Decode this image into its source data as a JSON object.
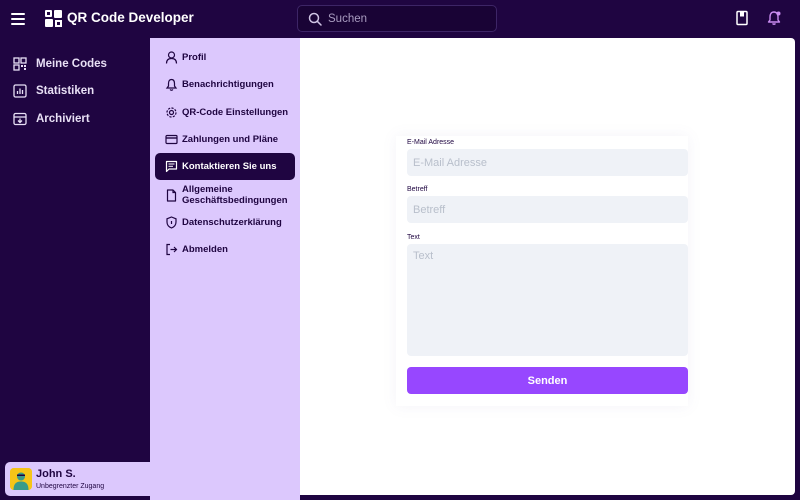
{
  "app": {
    "title": "QR Code Developer"
  },
  "search": {
    "placeholder": "Suchen"
  },
  "sidebar": {
    "items": [
      {
        "label": "Meine Codes",
        "icon": "qr-icon"
      },
      {
        "label": "Statistiken",
        "icon": "chart-icon"
      },
      {
        "label": "Archiviert",
        "icon": "archive-icon"
      }
    ]
  },
  "settings_menu": {
    "items": [
      {
        "label": "Profil",
        "icon": "user-icon"
      },
      {
        "label": "Benachrichtigungen",
        "icon": "bell-icon"
      },
      {
        "label": "QR-Code Einstellungen",
        "icon": "gear-icon"
      },
      {
        "label": "Zahlungen und Pläne",
        "icon": "credit-card-icon"
      },
      {
        "label": "Kontaktieren Sie uns",
        "icon": "message-icon",
        "active": true
      },
      {
        "label": "Allgemeine Geschäftsbedingungen",
        "icon": "document-icon"
      },
      {
        "label": "Datenschutzerklärung",
        "icon": "shield-icon"
      },
      {
        "label": "Abmelden",
        "icon": "logout-icon"
      }
    ]
  },
  "user": {
    "name": "John S.",
    "subtitle": "Unbegrenzter Zugang"
  },
  "contact_form": {
    "email_label": "E-Mail Adresse",
    "email_placeholder": "E-Mail Adresse",
    "subject_label": "Betreff",
    "subject_placeholder": "Betreff",
    "text_label": "Text",
    "text_placeholder": "Text",
    "submit_label": "Senden"
  },
  "colors": {
    "background": "#1f0541",
    "settings_panel": "#dcc8fd",
    "accent": "#9747ff",
    "input_bg": "#eff2f7"
  }
}
